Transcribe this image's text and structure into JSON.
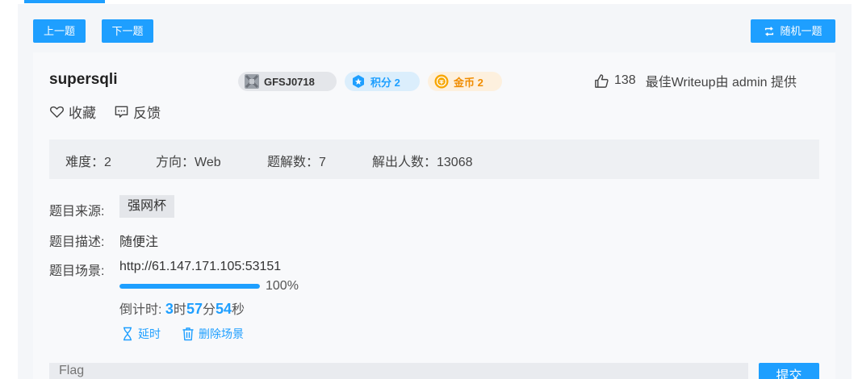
{
  "nav": {
    "prev_label": "上一题",
    "next_label": "下一题",
    "random_label": "随机一题"
  },
  "challenge": {
    "title": "supersqli",
    "id_badge": "GFSJ0718",
    "score_label": "积分 2",
    "gold_label": "金币 2",
    "likes": "138",
    "writeup_text": "最佳Writeup由 admin 提供",
    "favorite_label": "收藏",
    "feedback_label": "反馈"
  },
  "stats": {
    "difficulty": "难度：2",
    "direction": "方向：Web",
    "writeups": "题解数：7",
    "solvers": "解出人数：13068"
  },
  "details": {
    "source_label": "题目来源:",
    "source_value": "强网杯",
    "desc_label": "题目描述:",
    "desc_value": "随便注",
    "scene_label": "题目场景:",
    "scene_url": "http://61.147.171.105:53151",
    "progress_percent": 100,
    "progress_text": "100%",
    "countdown_prefix": "倒计时: ",
    "countdown_hours": "3",
    "countdown_h_unit": "时",
    "countdown_minutes": "57",
    "countdown_m_unit": "分",
    "countdown_seconds": "54",
    "countdown_s_unit": "秒",
    "delay_label": "延时",
    "delete_label": "删除场景"
  },
  "flag": {
    "placeholder": "Flag",
    "submit_label": "提交"
  },
  "colors": {
    "accent": "#1E9FFF",
    "gold": "#f08c00"
  },
  "icons": {
    "random": "repeat-icon",
    "score": "hexagon-star-icon",
    "gold": "coin-icon",
    "like": "thumbs-up-icon",
    "favorite": "heart-icon",
    "feedback": "message-icon",
    "delay": "hourglass-icon",
    "delete": "trash-icon"
  }
}
